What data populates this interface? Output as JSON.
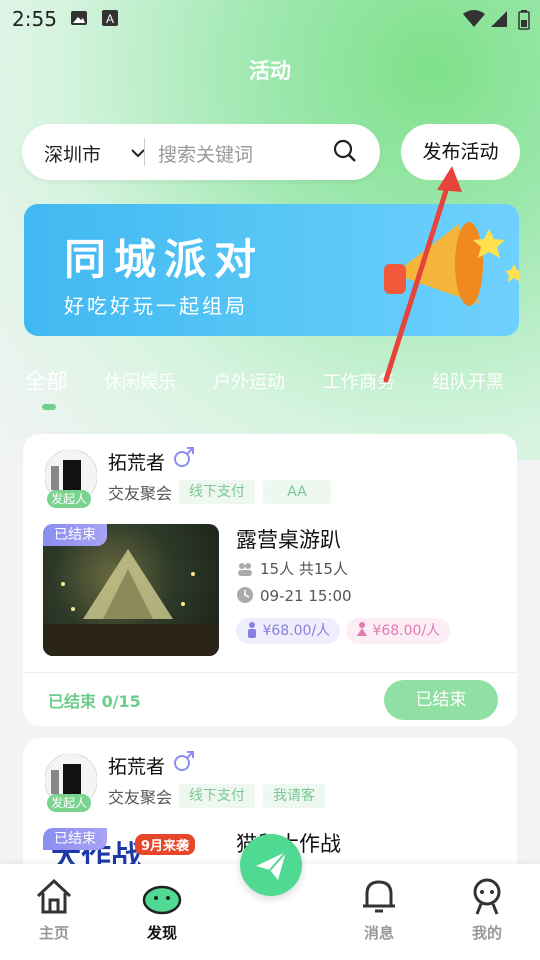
{
  "status_bar": {
    "time": "2:55"
  },
  "header": {
    "title": "活动"
  },
  "search": {
    "city": "深圳市",
    "placeholder": "搜索关键词"
  },
  "publish_button": "发布活动",
  "banner": {
    "title": "同城派对",
    "subtitle": "好吃好玩一起组局"
  },
  "tabs": [
    "全部",
    "休闲娱乐",
    "户外运动",
    "工作商务",
    "组队开黑"
  ],
  "activities": [
    {
      "host_name": "拓荒者",
      "host_badge": "发起人",
      "category": "交友聚会",
      "tags": [
        "线下支付",
        "AA"
      ],
      "ended_tag": "已结束",
      "title": "露营桌游趴",
      "people": "15人 共15人",
      "time": "09-21 15:00",
      "price_male": "¥68.00/人",
      "price_female": "¥68.00/人",
      "progress": "已结束 0/15",
      "status_button": "已结束"
    },
    {
      "host_name": "拓荒者",
      "host_badge": "发起人",
      "category": "交友聚会",
      "tags": [
        "线下支付",
        "我请客"
      ],
      "ended_tag": "已结束",
      "title": "猫鼠大作战",
      "thumb_text": "大作战",
      "thumb_sticker": "9月来袭"
    }
  ],
  "bottom_nav": [
    "主页",
    "发现",
    "消息",
    "我的"
  ],
  "colors": {
    "accent": "#4fd992",
    "tag_green": "#7ac992",
    "male": "#8a7fe0",
    "female": "#e27bb4"
  }
}
